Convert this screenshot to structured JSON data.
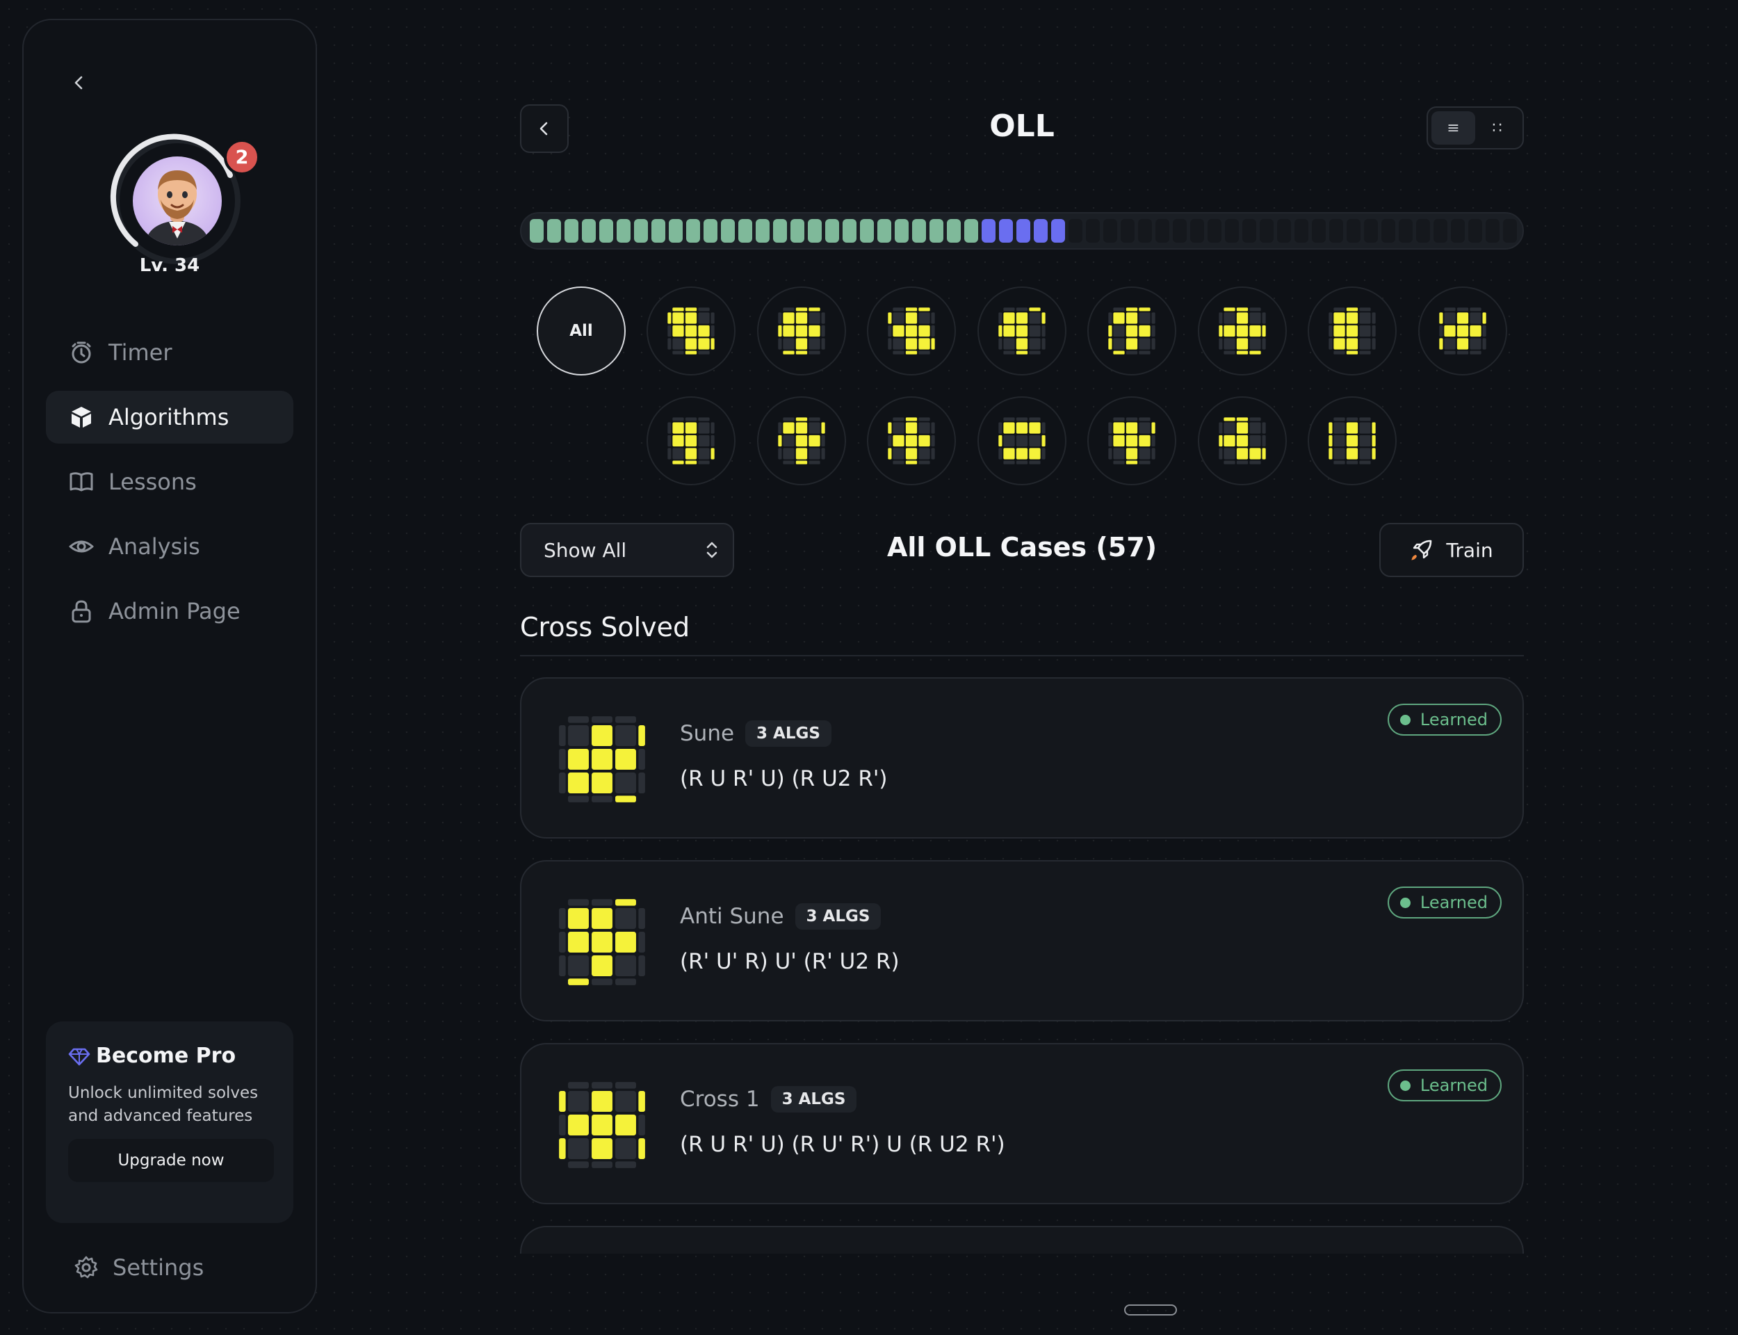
{
  "sidebar": {
    "level": "Lv. 34",
    "notifications": "2",
    "nav": [
      {
        "label": "Timer",
        "icon": "timer-icon"
      },
      {
        "label": "Algorithms",
        "icon": "cube-icon",
        "active": true
      },
      {
        "label": "Lessons",
        "icon": "book-icon"
      },
      {
        "label": "Analysis",
        "icon": "eye-icon"
      },
      {
        "label": "Admin Page",
        "icon": "lock-icon"
      }
    ],
    "pro": {
      "title": "Become Pro",
      "description": "Unlock unlimited solves and advanced features",
      "button": "Upgrade now"
    },
    "settings": "Settings"
  },
  "header": {
    "title": "OLL",
    "view_modes": [
      "list",
      "grid"
    ],
    "active_view": "list"
  },
  "progress": {
    "total": 57,
    "learned": 26,
    "learning": 5
  },
  "filters": {
    "all_label": "All",
    "group_count": 15
  },
  "controls": {
    "select_value": "Show All",
    "title": "All OLL Cases (57)",
    "train_label": "Train"
  },
  "section": {
    "title": "Cross Solved"
  },
  "cases": [
    {
      "name": "Sune",
      "algs": "3 ALGS",
      "formula": "(R U R' U) (R U2 R')",
      "status": "Learned"
    },
    {
      "name": "Anti Sune",
      "algs": "3 ALGS",
      "formula": "(R' U' R) U' (R' U2 R)",
      "status": "Learned"
    },
    {
      "name": "Cross 1",
      "algs": "3 ALGS",
      "formula": "(R U R' U) (R U' R') U (R U2 R')",
      "status": "Learned"
    }
  ],
  "colors": {
    "background": "#0e1116",
    "learned": "#7fb99a",
    "learning": "#6a6ef0",
    "sticker_yellow": "#f5f23a",
    "sticker_dark": "#2b2f36",
    "status_green": "#6cbf8d",
    "badge_red": "#d9534f"
  }
}
